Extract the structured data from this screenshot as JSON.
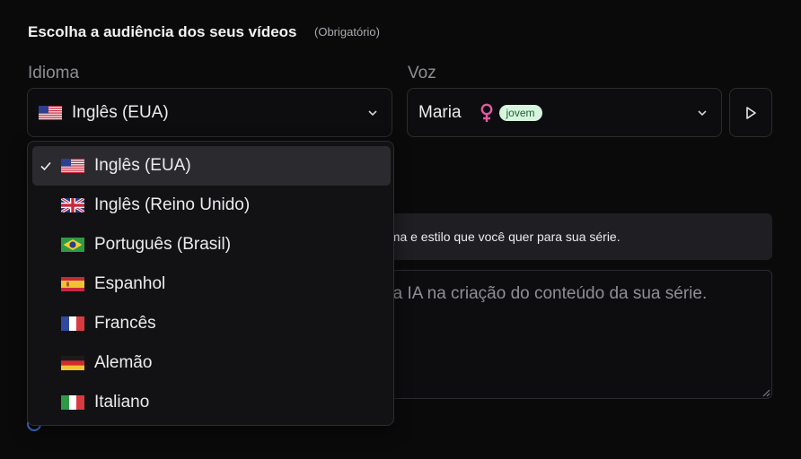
{
  "header": {
    "title": "Escolha a audiência dos seus vídeos",
    "required": "(Obrigatório)"
  },
  "language": {
    "label": "Idioma",
    "selected": "Inglês (EUA)",
    "options": [
      {
        "label": "Inglês (EUA)",
        "flag": "us-flag",
        "selected": true
      },
      {
        "label": "Inglês (Reino Unido)",
        "flag": "uk-flag",
        "selected": false
      },
      {
        "label": "Português (Brasil)",
        "flag": "brazil-flag",
        "selected": false
      },
      {
        "label": "Espanhol",
        "flag": "spain-flag",
        "selected": false
      },
      {
        "label": "Francês",
        "flag": "france-flag",
        "selected": false
      },
      {
        "label": "Alemão",
        "flag": "germany-flag",
        "selected": false
      },
      {
        "label": "Italiano",
        "flag": "italy-flag",
        "selected": false
      }
    ]
  },
  "voice": {
    "label": "Voz",
    "selected": "Maria",
    "badge": "jovem",
    "gender_icon": "female-icon"
  },
  "theme": {
    "info": "ema e estilo que você quer para sua série.",
    "placeholder": "r a IA na criação do conteúdo da sua série."
  },
  "colors": {
    "background": "#0a0a0b",
    "badge_bg": "#d7f5dd",
    "female": "#e05aa4",
    "accent": "#3a78d8"
  }
}
